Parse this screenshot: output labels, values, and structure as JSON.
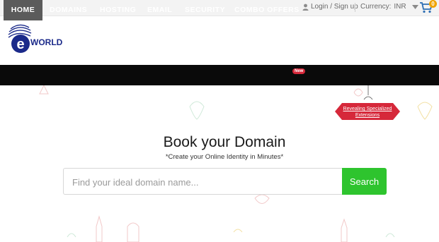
{
  "topbar": {
    "login_label": "Login / Sign up",
    "currency_label": "Currency:",
    "currency_value": "INR",
    "cart_count": "0"
  },
  "logo": {
    "text": "WORLD",
    "letter": "e",
    "brand_color": "#1b2a8a"
  },
  "nav": {
    "items": [
      {
        "label": "HOME",
        "active": true
      },
      {
        "label": "DOMAINS"
      },
      {
        "label": "HOSTING"
      },
      {
        "label": "EMAIL"
      },
      {
        "label": "SECURITY"
      },
      {
        "label": "COMBO OFFERS"
      }
    ],
    "new_badge": "New"
  },
  "ribbon": {
    "text": "Revealing Specialized Extensions",
    "color": "#d6283a"
  },
  "hero": {
    "title": "Book your Domain",
    "subtitle": "*Create your Online Identity in Minutes*",
    "search_placeholder": "Find your ideal domain name...",
    "search_button": "Search",
    "button_color": "#2ec42e"
  },
  "icons": {
    "user": "user-icon",
    "dropdown": "chevron-down-icon",
    "cart": "cart-icon"
  }
}
